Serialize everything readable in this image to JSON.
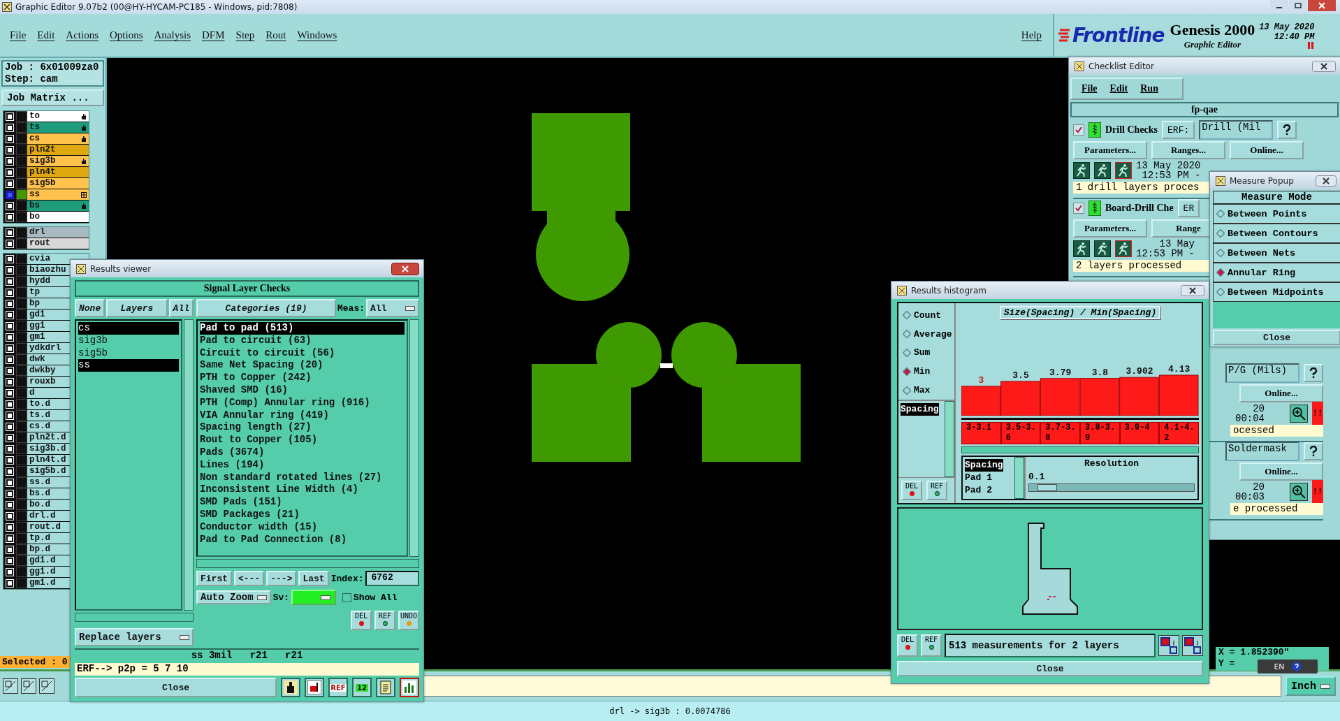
{
  "window": {
    "title": "Graphic Editor 9.07b2 (00@HY-HYCAM-PC185 - Windows, pid:7808)"
  },
  "menu": {
    "items": [
      "File",
      "Edit",
      "Actions",
      "Options",
      "Analysis",
      "DFM",
      "Step",
      "Rout",
      "Windows"
    ],
    "help": "Help"
  },
  "brand": {
    "logo": "Frontline",
    "product": "Genesis 2000",
    "subtitle": "Graphic Editor",
    "date": "13 May 2020",
    "time": "12:40 PM"
  },
  "job": {
    "job": "Job : 6x01009za0",
    "step": "Step: cam",
    "matrix": "Job Matrix ..."
  },
  "layer_groups": [
    [
      {
        "name": "to",
        "color": "#ffffff",
        "kind": "hand",
        "work": false
      },
      {
        "name": "ts",
        "color": "#1f9c7c",
        "kind": "hand",
        "work": false
      },
      {
        "name": "cs",
        "color": "#ffc24c",
        "kind": "hand",
        "work": false
      },
      {
        "name": "pln2t",
        "color": "#e0a810",
        "work": false
      },
      {
        "name": "sig3b",
        "color": "#ffc24c",
        "kind": "hand",
        "work": false
      },
      {
        "name": "pln4t",
        "color": "#e0a810",
        "work": false
      },
      {
        "name": "sig5b",
        "color": "#ffc24c",
        "work": false
      },
      {
        "name": "ss",
        "color": "#ffc24c",
        "kind": "grid",
        "work": true
      },
      {
        "name": "bs",
        "color": "#1f9c7c",
        "kind": "hand",
        "work": false
      },
      {
        "name": "bo",
        "color": "#ffffff",
        "work": false
      }
    ],
    [
      {
        "name": "drl",
        "color": "#a9b9c1",
        "work": false
      },
      {
        "name": "rout",
        "color": "#d8d8d8",
        "work": false
      }
    ],
    [
      {
        "name": "cvia",
        "work": false
      },
      {
        "name": "biaozhu",
        "work": false
      },
      {
        "name": "hydd",
        "work": false
      },
      {
        "name": "tp",
        "work": false
      },
      {
        "name": "bp",
        "work": false
      },
      {
        "name": "gd1",
        "work": false
      },
      {
        "name": "gg1",
        "work": false
      },
      {
        "name": "gm1",
        "work": false
      },
      {
        "name": "ydkdrl",
        "work": false
      },
      {
        "name": "dwk",
        "work": false
      },
      {
        "name": "dwkby",
        "work": false
      },
      {
        "name": "rouxb",
        "work": false
      },
      {
        "name": "d",
        "work": false
      },
      {
        "name": "to.d",
        "work": false
      },
      {
        "name": "ts.d",
        "work": false
      },
      {
        "name": "cs.d",
        "work": false
      },
      {
        "name": "pln2t.d",
        "work": false
      },
      {
        "name": "sig3b.d",
        "work": false
      },
      {
        "name": "pln4t.d",
        "work": false
      },
      {
        "name": "sig5b.d",
        "work": false
      },
      {
        "name": "ss.d",
        "work": false
      },
      {
        "name": "bs.d",
        "work": false
      },
      {
        "name": "bo.d",
        "work": false
      },
      {
        "name": "drl.d",
        "work": false
      },
      {
        "name": "rout.d",
        "work": false
      },
      {
        "name": "tp.d",
        "work": false
      },
      {
        "name": "bp.d",
        "work": false
      },
      {
        "name": "gd1.d",
        "work": false
      },
      {
        "name": "gg1.d",
        "work": false
      },
      {
        "name": "gm1.d",
        "work": false
      }
    ]
  ],
  "selected_count": "Selected : 0",
  "status_bar": "drl -> sig3b : 0.0074786",
  "units": "Inch",
  "coords": {
    "x": "X = 1.852390\"",
    "y": "Y ="
  },
  "language_bar": {
    "label": "EN"
  },
  "results_viewer": {
    "title": "Results viewer",
    "heading": "Signal Layer Checks",
    "none": "None",
    "layers": "Layers",
    "all": "All",
    "categories_label": "Categories (19)",
    "meas_label": "Meas:",
    "meas": "All",
    "layer_items": [
      {
        "name": "cs",
        "selected": true
      },
      {
        "name": "sig3b",
        "selected": false
      },
      {
        "name": "sig5b",
        "selected": false
      },
      {
        "name": "ss",
        "selected": true
      }
    ],
    "categories": [
      {
        "label": "Pad to pad (513)",
        "selected": true
      },
      {
        "label": "Pad to circuit (63)",
        "selected": false
      },
      {
        "label": "Circuit to circuit (56)",
        "selected": false
      },
      {
        "label": "Same Net Spacing (20)",
        "selected": false
      },
      {
        "label": "PTH to Copper (242)",
        "selected": false
      },
      {
        "label": "Shaved SMD (16)",
        "selected": false
      },
      {
        "label": "PTH (Comp) Annular ring (916)",
        "selected": false
      },
      {
        "label": "VIA Annular ring (419)",
        "selected": false
      },
      {
        "label": "Spacing length (27)",
        "selected": false
      },
      {
        "label": "Rout to Copper (105)",
        "selected": false
      },
      {
        "label": "Pads (3674)",
        "selected": false
      },
      {
        "label": "Lines (194)",
        "selected": false
      },
      {
        "label": "Non standard rotated lines (27)",
        "selected": false
      },
      {
        "label": "Inconsistent Line Width (4)",
        "selected": false
      },
      {
        "label": "SMD Pads (151)",
        "selected": false
      },
      {
        "label": "SMD Packages (21)",
        "selected": false
      },
      {
        "label": "Conductor width (15)",
        "selected": false
      },
      {
        "label": "Pad to Pad Connection (8)",
        "selected": false
      }
    ],
    "nav": [
      "First",
      "<---",
      "--->",
      "Last"
    ],
    "index_label": "Index:",
    "index": "6762",
    "zoom": "Auto Zoom",
    "sv_label": "Sv:",
    "show_all": {
      "label": "Show All",
      "checked": false
    },
    "replace": "Replace layers",
    "actions": [
      "DEL",
      "REF",
      "UNDO"
    ],
    "info": "ss 3mil   r21   r21",
    "erf": "ERF--> p2p = 5 7 10",
    "close": "Close",
    "tools": [
      {
        "kind": "figure",
        "selected": false
      },
      {
        "kind": "mark",
        "selected": false
      },
      {
        "kind": "ref",
        "text": "REF",
        "selected": false
      },
      {
        "kind": "count",
        "text": "12",
        "selected": false
      },
      {
        "kind": "report",
        "selected": false
      },
      {
        "kind": "chart",
        "selected": true
      }
    ]
  },
  "checklist": {
    "title": "Checklist Editor",
    "menu": [
      "File",
      "Edit",
      "Run"
    ],
    "name": "fp-qae",
    "entries": [
      {
        "kind": "full",
        "checked": true,
        "name": "Drill Checks",
        "erf": "ERF:",
        "field": "Drill (Mil",
        "buttons": [
          "Parameters...",
          "Ranges...",
          "Online..."
        ],
        "date": "13 May 2020",
        "time": "12:53 PM -",
        "status": "1 drill layers proces"
      },
      {
        "kind": "full",
        "checked": true,
        "name": "Board-Drill Che",
        "erf": "ER",
        "buttons": [
          "Parameters...",
          "Range"
        ],
        "date": "13 May",
        "time": "12:53 PM -",
        "status": "2 layers processed"
      },
      {
        "kind": "tail",
        "field": "P/G (Mils)",
        "buttons": [
          "Online..."
        ],
        "date": "20",
        "time": "00:04",
        "alert": "!!",
        "status": "ocessed"
      },
      {
        "kind": "tail",
        "field": "Soldermask",
        "buttons": [
          "Online..."
        ],
        "date": "20",
        "time": "00:03",
        "alert": "!!",
        "status": "e processed"
      }
    ]
  },
  "measure": {
    "title": "Measure Popup",
    "heading": "Measure Mode",
    "modes": [
      {
        "label": "Between Points",
        "selected": false
      },
      {
        "label": "Between Contours",
        "selected": false
      },
      {
        "label": "Between Nets",
        "selected": false
      },
      {
        "label": "Annular Ring",
        "selected": true
      },
      {
        "label": "Between Midpoints",
        "selected": false
      }
    ],
    "close": "Close"
  },
  "histogram": {
    "title": "Results histogram",
    "functions": [
      {
        "label": "Count",
        "selected": false
      },
      {
        "label": "Average",
        "selected": false
      },
      {
        "label": "Sum",
        "selected": false
      },
      {
        "label": "Min",
        "selected": true
      },
      {
        "label": "Max",
        "selected": false
      }
    ],
    "fields": [
      {
        "label": "Spacing",
        "selected": true
      }
    ],
    "actions": [
      "DEL",
      "REF"
    ],
    "chart_data": {
      "type": "bar",
      "title": "Size(Spacing) / Min(Spacing)",
      "categories": [
        "3-3.1",
        "3.5-3.6",
        "3.7-3.8",
        "3.8-3.9",
        "3.9-4",
        "4.1-4.2"
      ],
      "values": [
        3,
        3.5,
        3.79,
        3.8,
        3.902,
        4.13
      ],
      "data_labels": true
    },
    "attributes": [
      {
        "label": "Spacing",
        "selected": true
      },
      {
        "label": "Pad 1",
        "selected": false
      },
      {
        "label": "Pad 2",
        "selected": false
      }
    ],
    "resolution": {
      "label": "Resolution",
      "value": "0.1",
      "level": 0.05
    },
    "footer_actions": [
      "DEL",
      "REF"
    ],
    "summary": "513 measurements for 2 layers",
    "close": "Close"
  }
}
